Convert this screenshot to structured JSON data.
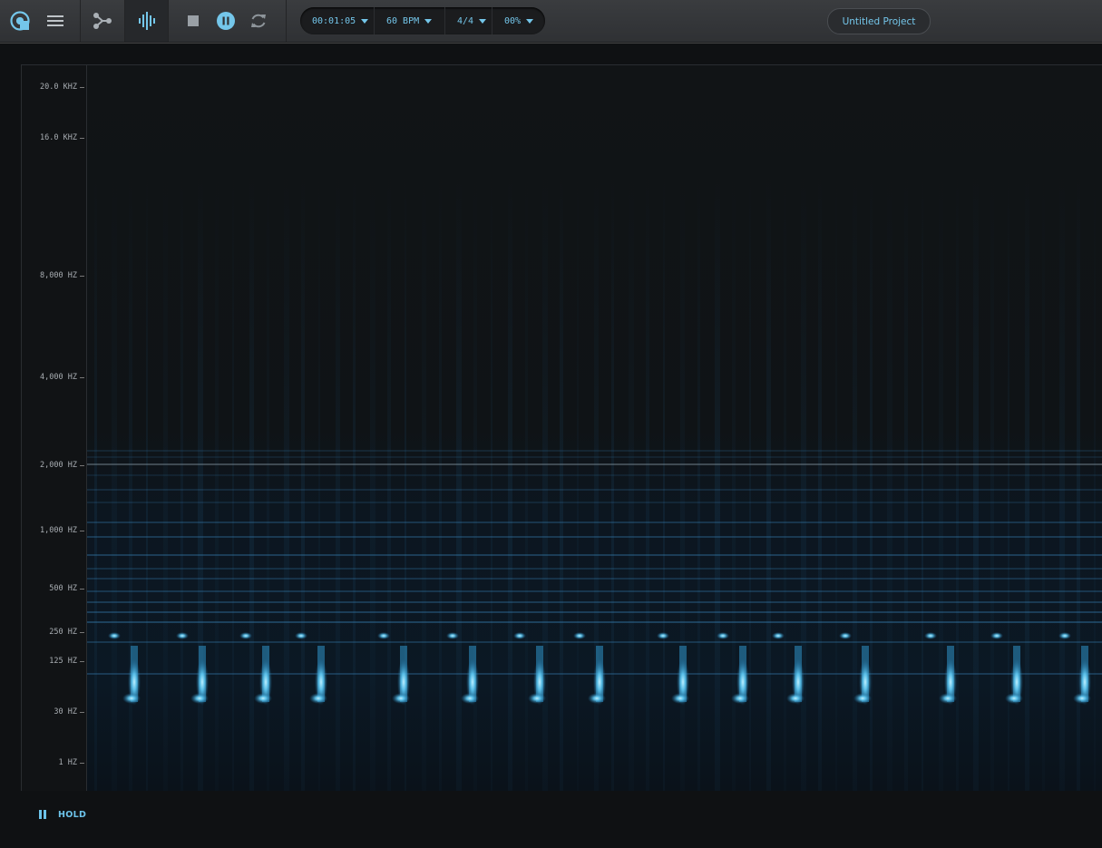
{
  "toolbar": {
    "icons": [
      "logo-icon",
      "menu-icon",
      "routing-icon",
      "spectrum-icon",
      "stop-icon",
      "pause-icon",
      "loop-icon"
    ],
    "time": "00:01:05",
    "tempo": "60 BPM",
    "signature": "4/4",
    "percent": "00%",
    "project_name": "Untitled Project",
    "accent_color": "#74c6ea"
  },
  "spectrogram": {
    "frequency_labels": [
      "20.0 KHZ",
      "16.0 KHZ",
      "8,000 HZ",
      "4,000 HZ",
      "2,000 HZ",
      "1,000 HZ",
      "500 HZ",
      "250 HZ",
      "125 HZ",
      "30 HZ",
      "1 HZ"
    ]
  },
  "footer": {
    "hold_label": "HOLD"
  }
}
